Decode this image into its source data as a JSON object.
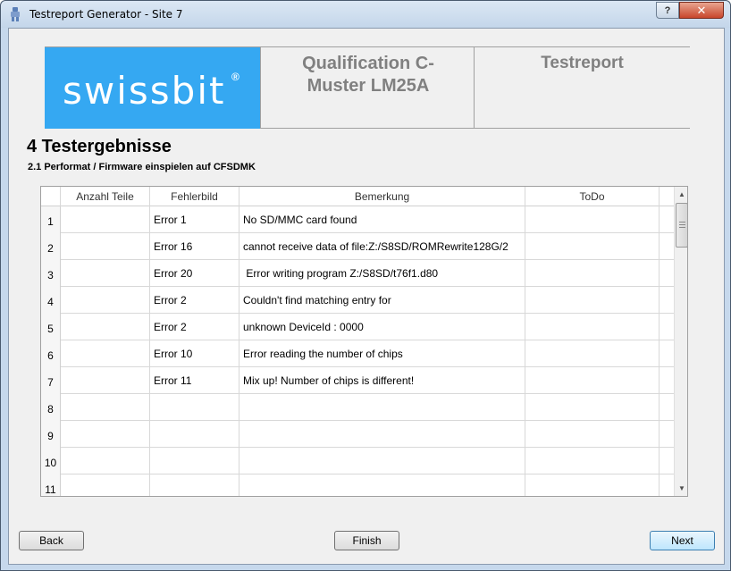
{
  "window": {
    "title": "Testreport Generator - Site 7",
    "help_label": "?",
    "close_label": "✕"
  },
  "header": {
    "logo_text": "swissbit",
    "logo_mark": "®",
    "qualification": "Qualification C-Muster LM25A",
    "report": "Testreport"
  },
  "section": {
    "title": "4 Testergebnisse",
    "subtitle": "2.1 Performat / Firmware einspielen auf CFSDMK"
  },
  "table": {
    "columns": [
      "Anzahl Teile",
      "Fehlerbild",
      "Bemerkung",
      "ToDo"
    ],
    "rows": [
      {
        "num": "1",
        "anzahl": "",
        "fehlerbild": "Error 1",
        "bemerkung": "No SD/MMC card found",
        "todo": ""
      },
      {
        "num": "2",
        "anzahl": "",
        "fehlerbild": "Error 16",
        "bemerkung": "cannot receive data of file:Z:/S8SD/ROMRewrite128G/2",
        "todo": ""
      },
      {
        "num": "3",
        "anzahl": "",
        "fehlerbild": "Error 20",
        "bemerkung": " Error writing program Z:/S8SD/t76f1.d80",
        "todo": ""
      },
      {
        "num": "4",
        "anzahl": "",
        "fehlerbild": "Error 2",
        "bemerkung": "Couldn't find matching entry for",
        "todo": ""
      },
      {
        "num": "5",
        "anzahl": "",
        "fehlerbild": "Error 2",
        "bemerkung": "unknown DeviceId : 0000",
        "todo": ""
      },
      {
        "num": "6",
        "anzahl": "",
        "fehlerbild": "Error 10",
        "bemerkung": "Error reading the number of chips",
        "todo": ""
      },
      {
        "num": "7",
        "anzahl": "",
        "fehlerbild": "Error 11",
        "bemerkung": "Mix up! Number of chips is different!",
        "todo": ""
      },
      {
        "num": "8",
        "anzahl": "",
        "fehlerbild": "",
        "bemerkung": "",
        "todo": ""
      },
      {
        "num": "9",
        "anzahl": "",
        "fehlerbild": "",
        "bemerkung": "",
        "todo": ""
      },
      {
        "num": "10",
        "anzahl": "",
        "fehlerbild": "",
        "bemerkung": "",
        "todo": ""
      },
      {
        "num": "11",
        "anzahl": "",
        "fehlerbild": "",
        "bemerkung": "",
        "todo": ""
      }
    ]
  },
  "buttons": {
    "back": "Back",
    "finish": "Finish",
    "next": "Next"
  },
  "colors": {
    "logo_bg": "#35a8f2",
    "header_text": "#808080"
  }
}
